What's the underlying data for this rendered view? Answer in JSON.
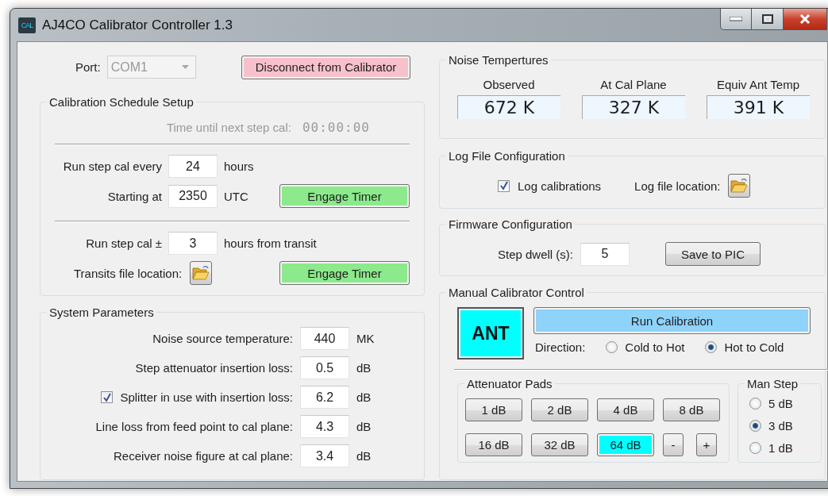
{
  "window": {
    "title": "AJ4CO Calibrator Controller 1.3",
    "icon_label": "CAL"
  },
  "port": {
    "label": "Port:",
    "value": "COM1",
    "disabled": true
  },
  "disconnect_button": "Disconnect from Calibrator",
  "schedule": {
    "title": "Calibration Schedule Setup",
    "countdown_label": "Time until next step cal:",
    "countdown": "00:00:00",
    "countdown_disabled": true,
    "sections": [
      {
        "rows": [
          {
            "kind": "field",
            "label": "Run step cal every",
            "value": "24",
            "unit": "hours"
          },
          {
            "kind": "field",
            "label": "Starting at",
            "value": "2350",
            "unit": "UTC",
            "button": "Engage Timer"
          }
        ]
      },
      {
        "rows": [
          {
            "kind": "field",
            "label": "Run step cal ±",
            "value": "3",
            "unit": "hours from transit"
          },
          {
            "kind": "folder",
            "label": "Transits file location:",
            "button": "Engage Timer"
          }
        ]
      }
    ]
  },
  "system": {
    "title": "System Parameters",
    "params": [
      {
        "kind": "plain",
        "label": "Noise source temperature:",
        "value": "440",
        "unit": "MK"
      },
      {
        "kind": "plain",
        "label": "Step attenuator insertion loss:",
        "value": "0.5",
        "unit": "dB"
      },
      {
        "kind": "checkbox",
        "label": "Splitter in use with insertion loss:",
        "checked": true,
        "value": "6.2",
        "unit": "dB"
      },
      {
        "kind": "plain",
        "label": "Line loss from feed point to cal plane:",
        "value": "4.3",
        "unit": "dB"
      },
      {
        "kind": "plain",
        "label": "Receiver noise figure at cal plane:",
        "value": "3.4",
        "unit": "dB"
      }
    ]
  },
  "noise": {
    "title": "Noise Tempertures",
    "readouts": [
      {
        "label": "Observed",
        "value": "672 K"
      },
      {
        "label": "At Cal Plane",
        "value": "327 K"
      },
      {
        "label": "Equiv Ant Temp",
        "value": "391 K"
      }
    ]
  },
  "log": {
    "title": "Log File Configuration",
    "log_calibrations": {
      "label": "Log calibrations",
      "checked": true
    },
    "location_label": "Log file location:"
  },
  "firmware": {
    "title": "Firmware Configuration",
    "dwell_label": "Step dwell (s):",
    "dwell_value": "5",
    "save_button": "Save to PIC"
  },
  "manual": {
    "title": "Manual Calibrator Control",
    "state": "ANT",
    "run_button": "Run Calibration",
    "direction_label": "Direction:",
    "directions": [
      {
        "label": "Cold to Hot",
        "selected": false
      },
      {
        "label": "Hot to Cold",
        "selected": true
      }
    ],
    "pads": {
      "title": "Attenuator Pads",
      "buttons": [
        {
          "kind": "pad",
          "label": "1 dB",
          "selected": false
        },
        {
          "kind": "pad",
          "label": "2 dB",
          "selected": false
        },
        {
          "kind": "pad",
          "label": "4 dB",
          "selected": false
        },
        {
          "kind": "pad",
          "label": "8 dB",
          "selected": false
        },
        {
          "kind": "pad",
          "label": "16 dB",
          "selected": false
        },
        {
          "kind": "pad",
          "label": "32 dB",
          "selected": false
        },
        {
          "kind": "pad",
          "label": "64 dB",
          "selected": true
        },
        {
          "kind": "step",
          "label": "-",
          "selected": false
        },
        {
          "kind": "step",
          "label": "+",
          "selected": false
        }
      ]
    },
    "man_step": {
      "title": "Man Step",
      "options": [
        {
          "label": "5 dB",
          "selected": false
        },
        {
          "label": "3 dB",
          "selected": true
        },
        {
          "label": "1 dB",
          "selected": false
        }
      ]
    }
  }
}
